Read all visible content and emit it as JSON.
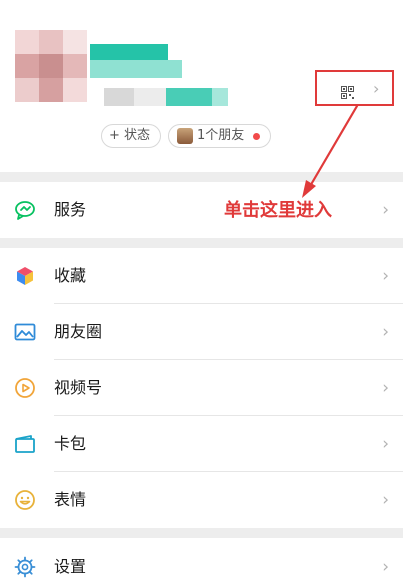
{
  "profile": {
    "status_label": "+ 状态",
    "friends_label": "1个朋友"
  },
  "annotation": {
    "text": "单击这里进入",
    "color": "#e03a3a"
  },
  "menu": {
    "service": {
      "label": "服务",
      "icon": "service-icon"
    },
    "favorites": {
      "label": "收藏",
      "icon": "favorites-cube-icon"
    },
    "moments": {
      "label": "朋友圈",
      "icon": "moments-picture-icon"
    },
    "channels": {
      "label": "视频号",
      "icon": "channels-play-icon"
    },
    "cards": {
      "label": "卡包",
      "icon": "card-wallet-icon"
    },
    "stickers": {
      "label": "表情",
      "icon": "smiley-icon"
    },
    "settings": {
      "label": "设置",
      "icon": "gear-icon"
    }
  },
  "colors": {
    "accent_green": "#07c160",
    "highlight_red": "#e03a3a",
    "background_gray": "#ededed"
  }
}
